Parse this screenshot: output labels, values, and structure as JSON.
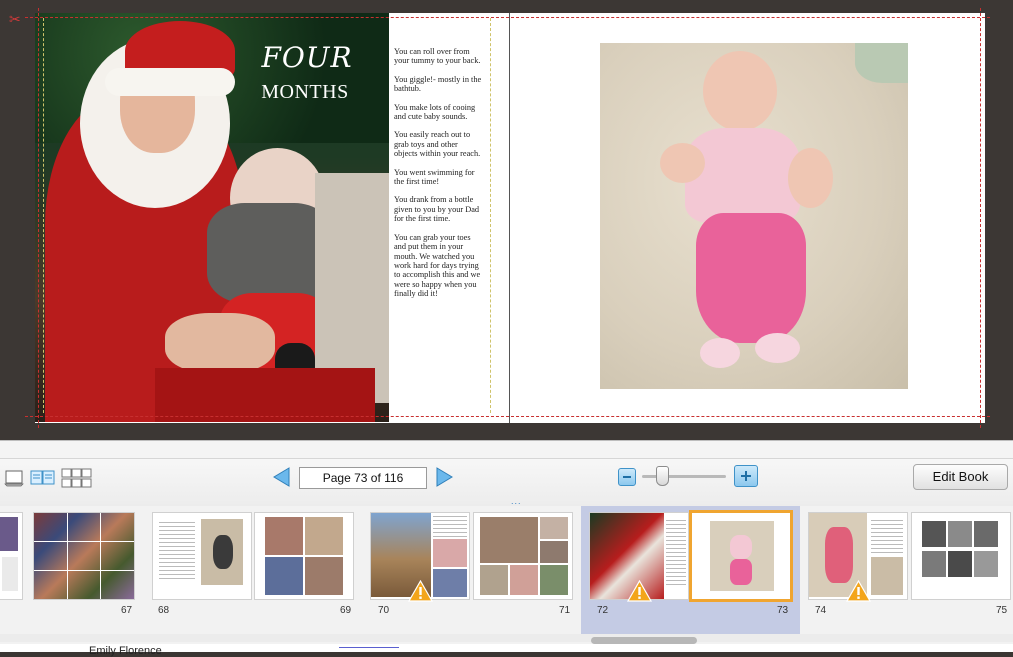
{
  "book": {
    "title_line1": "FOUR",
    "title_line2": "MONTHS",
    "text_paragraphs": [
      "You can roll over from your tummy to your back.",
      "You giggle!- mostly in the bathtub.",
      "You make lots of cooing and cute baby sounds.",
      "You easily reach out to grab toys and other objects within your reach.",
      "You went swimming for the first time!",
      "You drank from a bottle given to you by your Dad for the first time.",
      "You can grab your toes and put them in your mouth. We watched you work hard for days trying to accomplish this and we were so happy when you finally did it!"
    ]
  },
  "toolbar": {
    "page_indicator": "Page 73 of 116",
    "edit_book_label": "Edit Book",
    "divider_dots": "...",
    "view_icons": [
      "single-page-view-icon",
      "spread-view-icon",
      "all-pages-view-icon"
    ]
  },
  "thumbnails": {
    "page_numbers": [
      "67",
      "68",
      "69",
      "70",
      "71",
      "72",
      "73",
      "74",
      "75"
    ],
    "selected_pages": [
      "72",
      "73"
    ],
    "warning_pages": [
      "70",
      "72",
      "74"
    ]
  },
  "below": {
    "text": "Emily Florence"
  },
  "colors": {
    "canvas_bg": "#3c3734",
    "guide_red": "#c83030",
    "accent_blue": "#3f92c8",
    "selection_fill": "#c4cbe4",
    "selection_border": "#f0a530",
    "warning": "#f3a51b"
  }
}
